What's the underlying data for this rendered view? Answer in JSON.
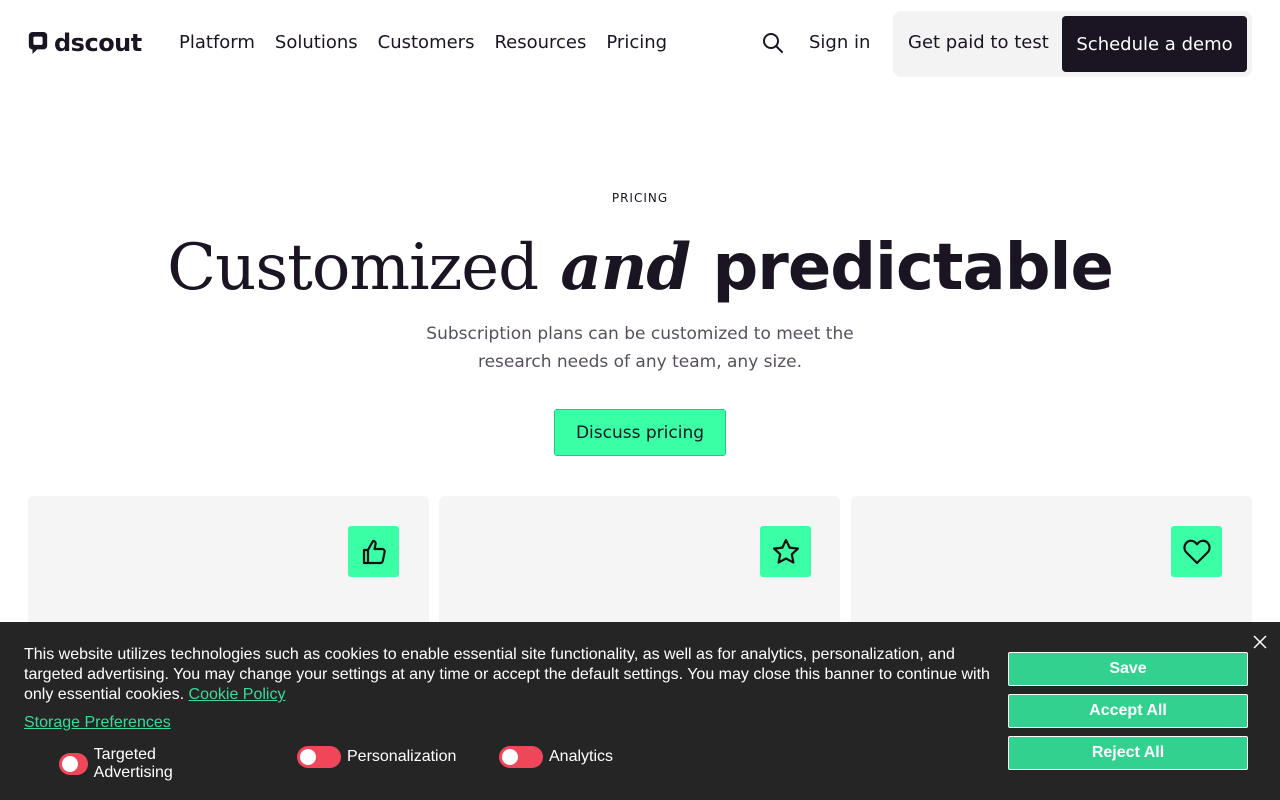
{
  "header": {
    "logo_text": "dscout",
    "nav": [
      "Platform",
      "Solutions",
      "Customers",
      "Resources",
      "Pricing"
    ],
    "signin": "Sign in",
    "get_paid": "Get paid to test",
    "demo": "Schedule a demo"
  },
  "hero": {
    "eyebrow": "PRICING",
    "headline_part1": "Customized",
    "headline_part2": "and",
    "headline_part3": "predictable",
    "subtext": "Subscription plans can be customized to meet the research needs of any team, any size.",
    "cta": "Discuss pricing"
  },
  "cards": [
    {
      "icon": "thumbs-up-icon"
    },
    {
      "icon": "star-icon"
    },
    {
      "icon": "heart-icon"
    }
  ],
  "cookie": {
    "text": "This website utilizes technologies such as cookies to enable essential site functionality, as well as for analytics, personalization, and targeted advertising. You may change your settings at any time or accept the default settings. You may close this banner to continue with only essential cookies.",
    "policy_link": "Cookie Policy",
    "storage_link": "Storage Preferences",
    "toggles": [
      "Targeted Advertising",
      "Personalization",
      "Analytics"
    ],
    "buttons": {
      "save": "Save",
      "accept": "Accept All",
      "reject": "Reject All"
    }
  },
  "colors": {
    "accent_green": "#3bffa5",
    "dark": "#1a1423",
    "banner_bg": "#252525",
    "banner_button": "#33d18f",
    "toggle_off": "#f0465a"
  }
}
